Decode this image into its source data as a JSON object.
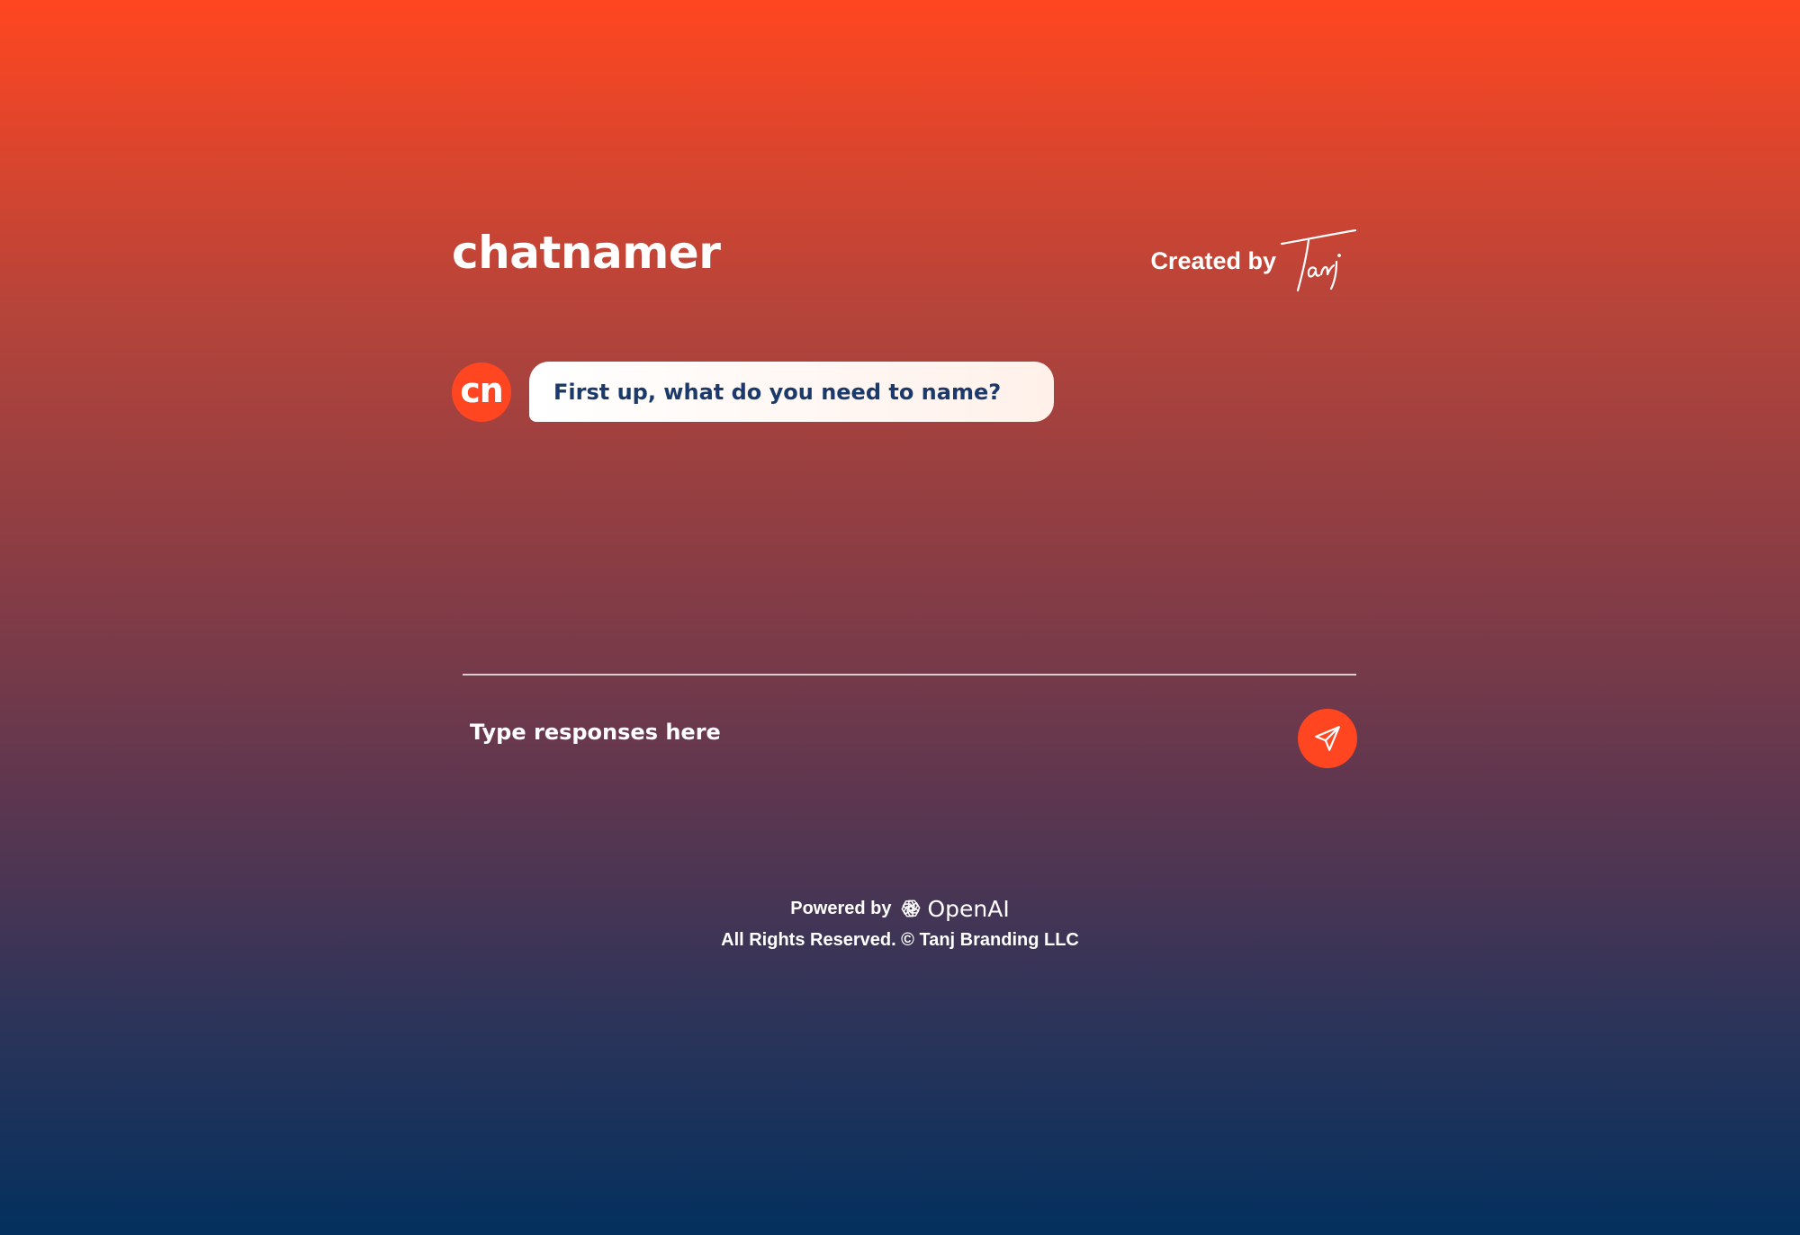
{
  "header": {
    "app_title": "chatnamer",
    "created_by_label": "Created by",
    "signature_text": "Tanj"
  },
  "chat": {
    "avatar_initials": "cn",
    "messages": [
      {
        "sender": "bot",
        "text": "First up, what do you need to name?"
      }
    ]
  },
  "composer": {
    "placeholder": "Type responses here",
    "value": "",
    "send_icon": "paper-plane-icon"
  },
  "footer": {
    "powered_by_label": "Powered by",
    "provider_name": "OpenAI",
    "provider_icon": "openai-logo-icon",
    "rights_text": "All Rights Reserved. © Tanj Branding LLC"
  },
  "colors": {
    "gradient_top": "#FF4620",
    "gradient_bottom": "#03305E",
    "accent": "#FF4620",
    "bubble_text": "#1B3A6B",
    "text": "#FFFFFF"
  }
}
